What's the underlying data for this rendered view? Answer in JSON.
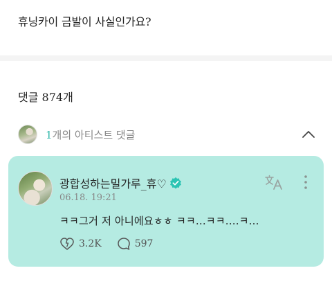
{
  "post": {
    "title": "휴닝카이 금발이 사실인가요?"
  },
  "comments": {
    "count_label": "댓글 874개"
  },
  "artist_comments": {
    "count": "1",
    "suffix": "개의 아티스트 댓글"
  },
  "comment": {
    "username": "광합성하는밀가루_휴♡",
    "timestamp": "06.18. 19:21",
    "text": "ㅋㅋ그거 저 아니에요ㅎㅎ ㅋㅋ...ㅋㅋ....ㅋ...",
    "likes": "3.2K",
    "replies": "597"
  },
  "colors": {
    "card_bg": "#b5ebe2",
    "accent": "#2bb6a8",
    "verified": "#2bc4b3"
  },
  "icons": [
    "chevron-up-icon",
    "verified-badge-icon",
    "translate-icon",
    "more-vertical-icon",
    "like-icon",
    "reply-icon"
  ]
}
